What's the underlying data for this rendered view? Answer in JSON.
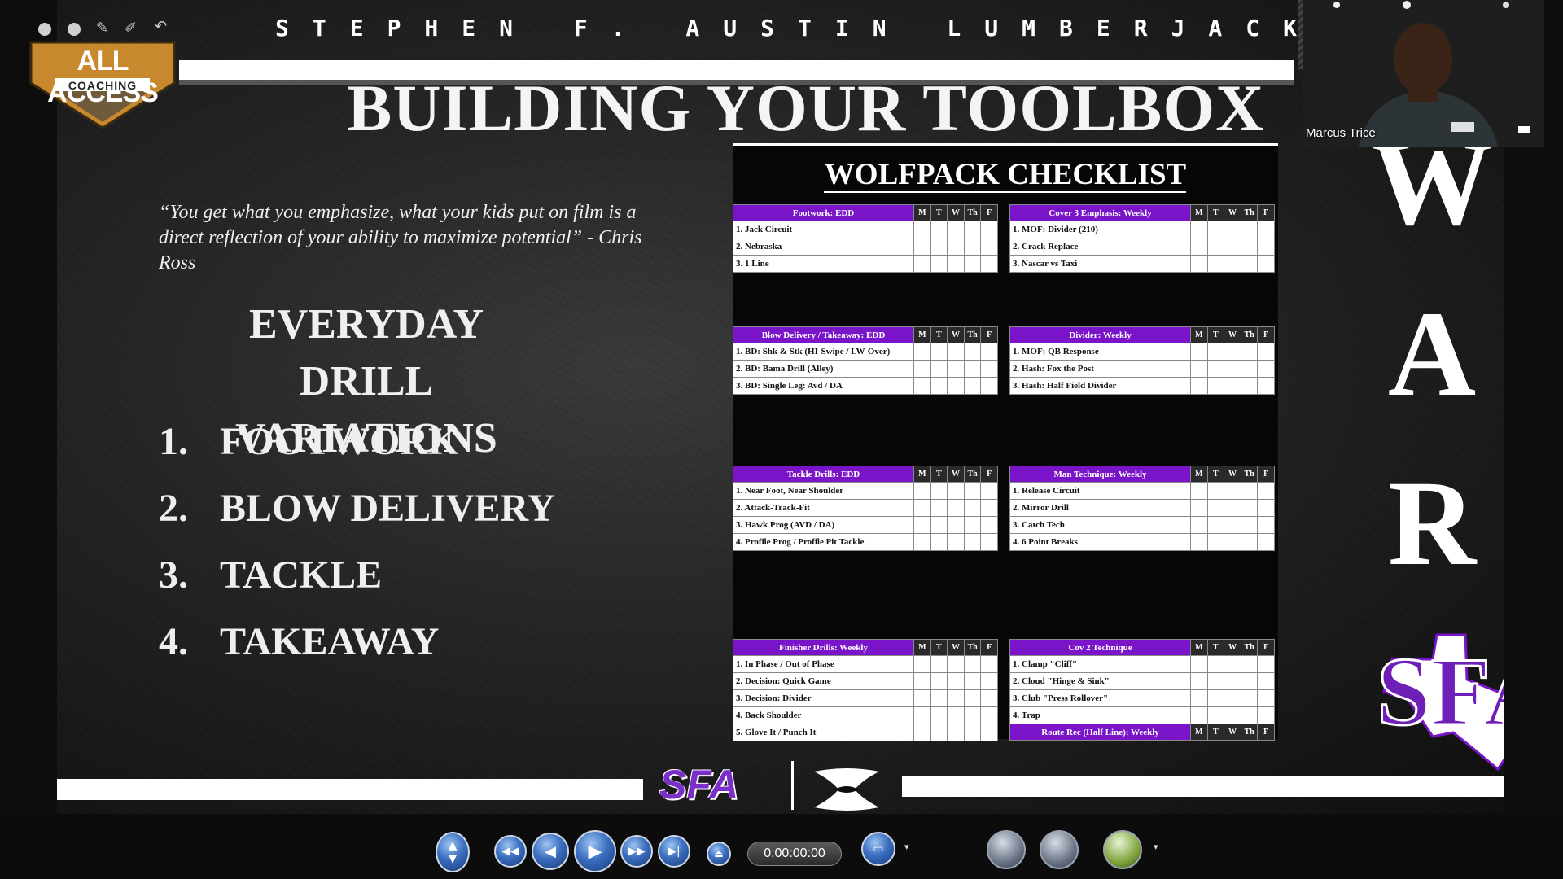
{
  "header": {
    "school_banner": "STEPHEN F. AUSTIN LUMBERJACK"
  },
  "branding": {
    "all_access": "ALL ACCESS",
    "coaching": "COACHING",
    "footer_sfa": "SFA",
    "war_letters": [
      "W",
      "A",
      "R"
    ]
  },
  "slide": {
    "title": "BUILDING YOUR TOOLBOX",
    "quote": "“You get what you emphasize, what your kids put on film is a direct reflection of your ability to maximize potential” - Chris Ross",
    "drill_heading_1": "EVERYDAY DRILL",
    "drill_heading_2": "VARIATIONS",
    "drill_list": [
      {
        "num": "1.",
        "label": "FOOTWORK"
      },
      {
        "num": "2.",
        "label": "BLOW DELIVERY"
      },
      {
        "num": "3.",
        "label": "TACKLE"
      },
      {
        "num": "4.",
        "label": "TAKEAWAY"
      }
    ]
  },
  "checklist": {
    "title": "WOLFPACK CHECKLIST",
    "days": [
      "M",
      "T",
      "W",
      "Th",
      "F"
    ],
    "tables": [
      {
        "header": "Footwork: EDD",
        "rows": [
          "1. Jack Circuit",
          "2. Nebraska",
          "3. 1 Line"
        ]
      },
      {
        "header": "Cover 3 Emphasis: Weekly",
        "rows": [
          "1. MOF: Divider (210)",
          "2. Crack Replace",
          "3. Nascar vs Taxi"
        ]
      },
      {
        "header": "Blow Delivery / Takeaway: EDD",
        "rows": [
          "1. BD: Shk & Stk (HI-Swipe / LW-Over)",
          "2. BD: Bama Drill (Alley)",
          "3. BD: Single Leg: Avd / DA"
        ]
      },
      {
        "header": "Divider: Weekly",
        "rows": [
          "1. MOF: QB Response",
          "2. Hash: Fox the Post",
          "3. Hash: Half Field Divider"
        ]
      },
      {
        "header": "Tackle Drills: EDD",
        "rows": [
          "1. Near Foot, Near Shoulder",
          "2. Attack-Track-Fit",
          "3. Hawk Prog (AVD / DA)",
          "4. Profile Prog / Profile Pit Tackle"
        ]
      },
      {
        "header": "Man Technique: Weekly",
        "rows": [
          "1. Release Circuit",
          "2. Mirror Drill",
          "3. Catch Tech",
          "4. 6 Point Breaks"
        ]
      },
      {
        "header": "Finisher Drills: Weekly",
        "rows": [
          "1. In Phase / Out of Phase",
          "2. Decision: Quick Game",
          "3. Decision: Divider",
          "4. Back Shoulder",
          "5. Glove It / Punch It"
        ]
      },
      {
        "header": "Cov 2 Technique",
        "rows": [
          "1. Clamp \"Cliff\"",
          "2. Cloud \"Hinge & Sink\"",
          "3. Club \"Press Rollover\"",
          "4. Trap"
        ],
        "extra_header": "Route Rec (Half Line): Weekly"
      }
    ]
  },
  "webcam": {
    "participant_name": "Marcus Trice"
  },
  "player": {
    "time": "0:00:00:00"
  },
  "colors": {
    "accent_purple": "#7a14c8",
    "gold": "#c8892e",
    "control_blue": "#3c6fc0"
  }
}
